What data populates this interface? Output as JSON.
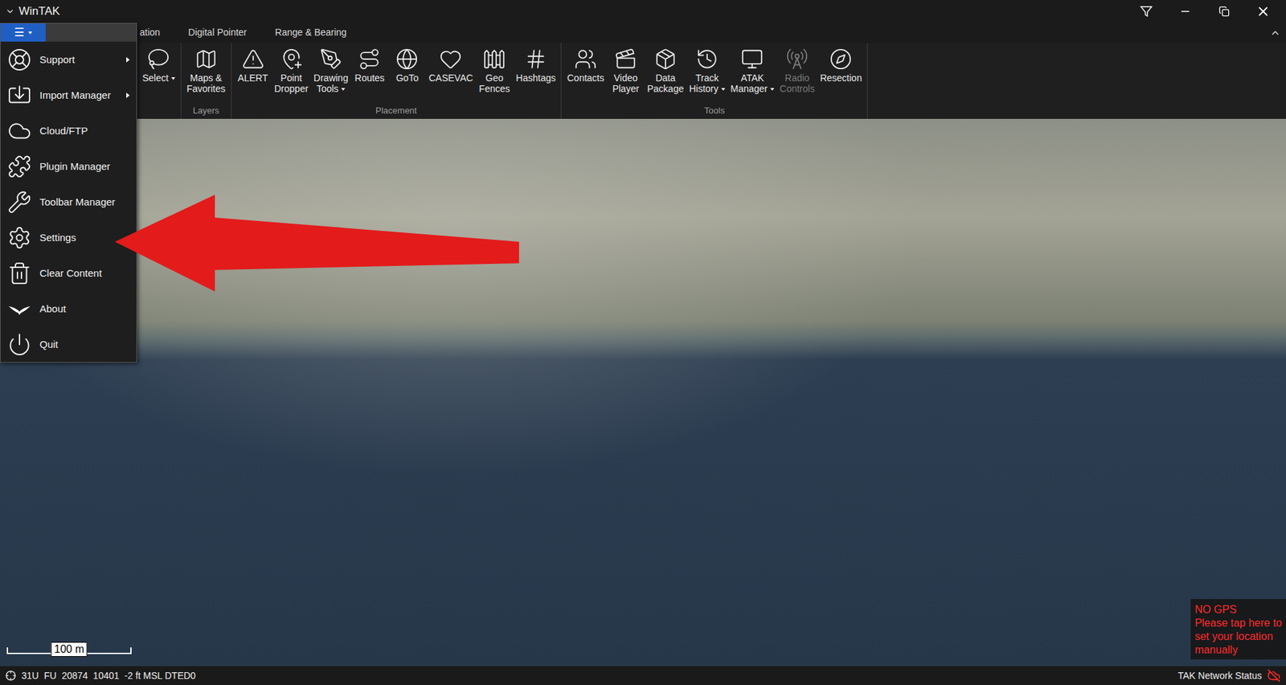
{
  "window": {
    "title": "WinTAK"
  },
  "tabs": [
    {
      "label": "ation",
      "selected": false
    },
    {
      "label": "Digital Pointer",
      "selected": false
    },
    {
      "label": "Range & Bearing",
      "selected": false
    }
  ],
  "ribbon": {
    "groups": [
      {
        "buttons": [
          {
            "lines": [
              "Select"
            ],
            "dropdown": true,
            "disabled": false
          }
        ]
      },
      {
        "label": "Layers",
        "buttons": [
          {
            "lines": [
              "Maps &",
              "Favorites"
            ],
            "dropdown": false,
            "disabled": false
          }
        ]
      },
      {
        "label": "Placement",
        "buttons": [
          {
            "lines": [
              "ALERT"
            ],
            "dropdown": false,
            "disabled": false
          },
          {
            "lines": [
              "Point",
              "Dropper"
            ],
            "dropdown": false,
            "disabled": false
          },
          {
            "lines": [
              "Drawing",
              "Tools"
            ],
            "dropdown": true,
            "disabled": false
          },
          {
            "lines": [
              "Routes"
            ],
            "dropdown": false,
            "disabled": false
          },
          {
            "lines": [
              "GoTo"
            ],
            "dropdown": false,
            "disabled": false
          },
          {
            "lines": [
              "CASEVAC"
            ],
            "dropdown": false,
            "disabled": false
          },
          {
            "lines": [
              "Geo",
              "Fences"
            ],
            "dropdown": false,
            "disabled": false
          },
          {
            "lines": [
              "Hashtags"
            ],
            "dropdown": false,
            "disabled": false
          }
        ]
      },
      {
        "label": "Tools",
        "buttons": [
          {
            "lines": [
              "Contacts"
            ],
            "dropdown": false,
            "disabled": false
          },
          {
            "lines": [
              "Video",
              "Player"
            ],
            "dropdown": false,
            "disabled": false
          },
          {
            "lines": [
              "Data",
              "Package"
            ],
            "dropdown": false,
            "disabled": false
          },
          {
            "lines": [
              "Track",
              "History"
            ],
            "dropdown": true,
            "disabled": false
          },
          {
            "lines": [
              "ATAK",
              "Manager"
            ],
            "dropdown": true,
            "disabled": false
          },
          {
            "lines": [
              "Radio",
              "Controls"
            ],
            "dropdown": false,
            "disabled": true
          },
          {
            "lines": [
              "Resection"
            ],
            "dropdown": false,
            "disabled": false
          }
        ]
      }
    ]
  },
  "menu": {
    "glyph": "☰",
    "open": true,
    "items": [
      {
        "label": "Support",
        "submenu": true
      },
      {
        "label": "Import Manager",
        "submenu": true
      },
      {
        "label": "Cloud/FTP",
        "submenu": false
      },
      {
        "label": "Plugin Manager",
        "submenu": false
      },
      {
        "label": "Toolbar Manager",
        "submenu": false
      },
      {
        "label": "Settings",
        "submenu": false
      },
      {
        "label": "Clear Content",
        "submenu": false
      },
      {
        "label": "About",
        "submenu": false
      },
      {
        "label": "Quit",
        "submenu": false
      }
    ]
  },
  "map": {
    "scale": "100 m"
  },
  "gps_notice": {
    "title": "NO GPS",
    "lines": [
      "Please tap here to",
      "set your location",
      "manually"
    ]
  },
  "status_bar": {
    "coordinates": "31U  FU  20874  10401  -2 ft MSL DTED0",
    "network": "TAK Network Status",
    "connected": false
  }
}
